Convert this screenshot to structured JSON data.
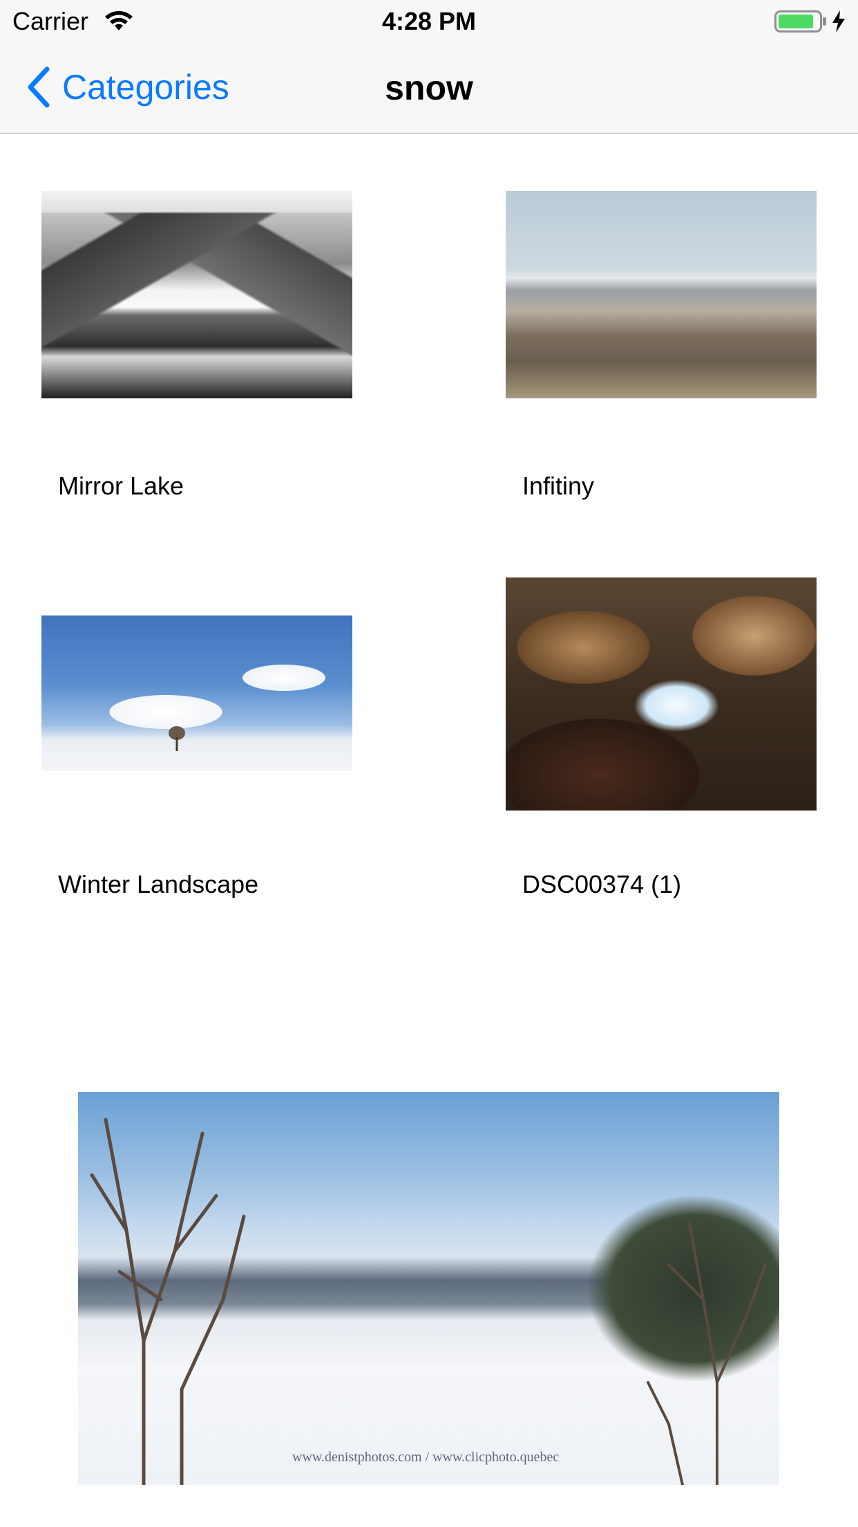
{
  "status_bar": {
    "carrier": "Carrier",
    "time": "4:28 PM",
    "icons": [
      "wifi-icon",
      "battery-icon",
      "charging-bolt-icon"
    ],
    "battery_color": "#4cd964"
  },
  "nav": {
    "back_label": "Categories",
    "back_icon": "chevron-left-icon",
    "title": "snow",
    "tint": "#0a7aff"
  },
  "grid": {
    "items": [
      {
        "caption": "Mirror Lake"
      },
      {
        "caption": "Infitiny"
      },
      {
        "caption": "Winter Landscape"
      },
      {
        "caption": "DSC00374 (1)"
      }
    ]
  },
  "featured": {
    "watermark": "www.denistphotos.com / www.clicphoto.quebec"
  }
}
